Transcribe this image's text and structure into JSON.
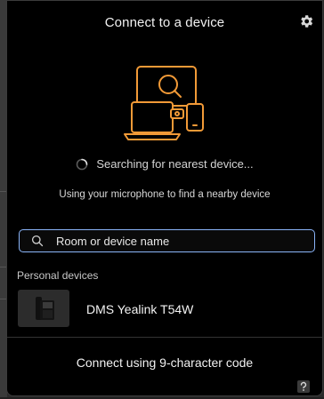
{
  "dialog": {
    "title": "Connect to a device"
  },
  "icons": {
    "settings": "gear-icon",
    "illustration": "device-search-illustration",
    "spinner": "loading-spinner-icon",
    "search": "search-icon",
    "desk_phone": "desk-phone-icon",
    "corner": "help-icon"
  },
  "status": {
    "searching_text": "Searching for nearest device...",
    "hint_text": "Using your microphone to find a nearby device"
  },
  "search": {
    "placeholder": "Room or device name",
    "value": ""
  },
  "personal_devices": {
    "section_label": "Personal devices",
    "items": [
      {
        "name": "DMS Yealink T54W"
      }
    ]
  },
  "footer": {
    "connect_code_label": "Connect using 9-character code"
  },
  "colors": {
    "accent_orange": "#f29a37",
    "search_border": "#8ab4f8",
    "panel_background": "#000000"
  }
}
